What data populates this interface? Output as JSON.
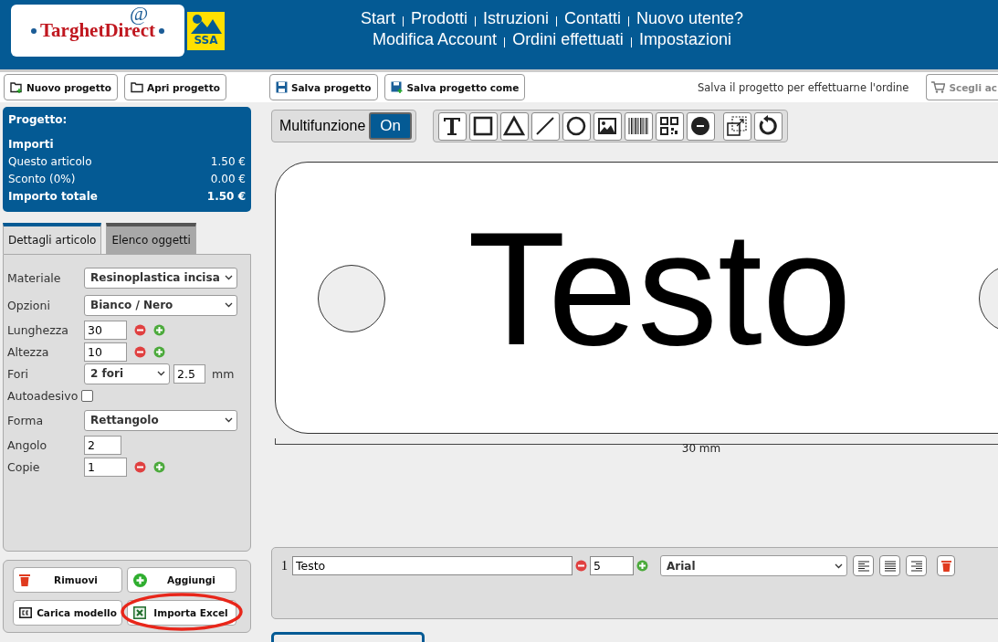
{
  "logo": {
    "name": "TarghetDirect",
    "at": "@",
    "badge": "SSA"
  },
  "nav": [
    [
      "Start",
      "Prodotti",
      "Istruzioni",
      "Contatti",
      "Nuovo utente?"
    ],
    [
      "Modifica Account",
      "Ordini effettuati",
      "Impostazioni"
    ]
  ],
  "toolbar": {
    "buttons": [
      {
        "label": "Nuovo progetto",
        "kind": "new"
      },
      {
        "label": "Apri progetto",
        "kind": "open"
      },
      {
        "label": "Salva progetto",
        "kind": "save"
      },
      {
        "label": "Salva progetto come",
        "kind": "saveas"
      }
    ],
    "hint": "Salva il progetto per effettuarne l'ordine",
    "cart_button": "Scegli ac"
  },
  "summary": {
    "title": "Progetto:",
    "heading": "Importi",
    "rows": [
      {
        "label": "Questo articolo",
        "value": "1.50 €",
        "bold": false
      },
      {
        "label": "Sconto (0%)",
        "value": "0.00 €",
        "bold": false
      },
      {
        "label": "Importo totale",
        "value": "1.50 €",
        "bold": true
      }
    ]
  },
  "tabs": [
    {
      "label": "Dettagli articolo",
      "selected": true
    },
    {
      "label": "Elenco oggetti",
      "selected": false
    }
  ],
  "fields": [
    {
      "kind": "select",
      "label": "Materiale",
      "value": "Resinoplastica incisa"
    },
    {
      "kind": "select",
      "label": "Opzioni",
      "value": "Bianco / Nero"
    },
    {
      "kind": "number",
      "label": "Lunghezza",
      "value": "30",
      "stepper": true
    },
    {
      "kind": "number",
      "label": "Altezza",
      "value": "10",
      "stepper": true
    },
    {
      "kind": "holes",
      "label": "Fori",
      "value": "2 fori",
      "size": "2.5",
      "unit": "mm"
    },
    {
      "kind": "checkbox",
      "label": "Autoadesivo",
      "checked": false
    },
    {
      "kind": "select",
      "label": "Forma",
      "value": "Rettangolo"
    },
    {
      "kind": "number",
      "label": "Angolo",
      "value": "2",
      "stepper": false
    },
    {
      "kind": "number",
      "label": "Copie",
      "value": "1",
      "stepper": true
    }
  ],
  "actions": [
    {
      "label": "Rimuovi",
      "kind": "remove"
    },
    {
      "label": "Aggiungi",
      "kind": "add"
    },
    {
      "label": "Carica modello",
      "kind": "template"
    },
    {
      "label": "Importa Excel",
      "kind": "excel",
      "circled": true
    }
  ],
  "mode": {
    "label": "Multifunzione",
    "toggle": "On",
    "on": true
  },
  "canvas": {
    "text": "Testo",
    "dimension": "30 mm"
  },
  "text_rows": [
    {
      "index": "1",
      "text": "Testo",
      "size": "5",
      "font": "Arial"
    }
  ]
}
